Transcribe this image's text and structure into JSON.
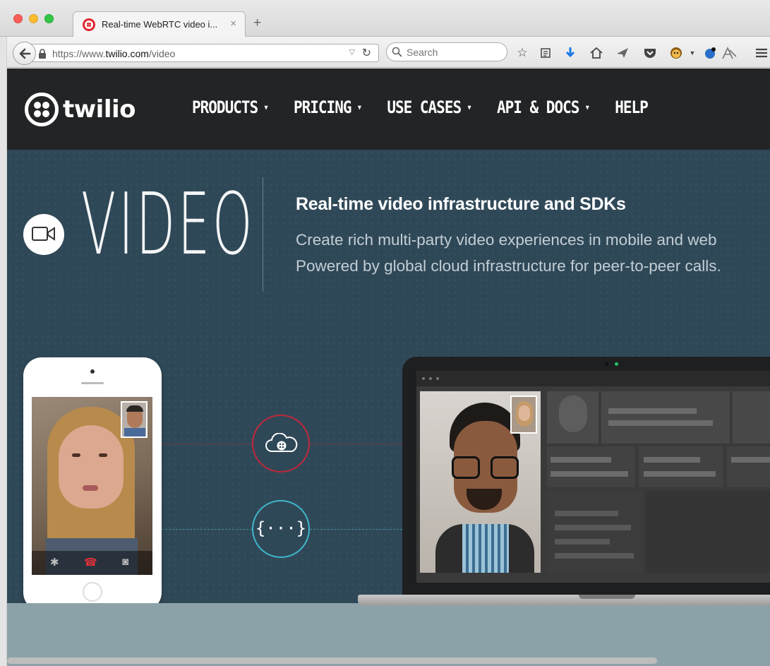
{
  "browser": {
    "tab": {
      "title": "Real-time WebRTC video i...",
      "close": "×"
    },
    "new_tab": "+",
    "url": {
      "scheme": "https://www.",
      "domain": "twilio.com",
      "path": "/video"
    },
    "search": {
      "placeholder": "Search"
    },
    "toolbar_icons": [
      "star-icon",
      "reading-list-icon",
      "download-icon",
      "home-icon",
      "send-icon",
      "pocket-icon",
      "monkey-icon",
      "globe-icon",
      "font-icon",
      "menu-icon"
    ]
  },
  "site": {
    "logo_text": "twilio",
    "nav": [
      {
        "label": "PRODUCTS",
        "caret": "▾"
      },
      {
        "label": "PRICING",
        "caret": "▾"
      },
      {
        "label": "USE CASES",
        "caret": "▾"
      },
      {
        "label": "API & DOCS",
        "caret": "▾"
      },
      {
        "label": "HELP",
        "caret": ""
      }
    ]
  },
  "hero": {
    "product": "VIDEO",
    "heading": "Real-time video infrastructure and SDKs",
    "line1": "Create rich multi-party video experiences in mobile and web",
    "line2": "Powered by global cloud infrastructure for peer-to-peer calls."
  },
  "illustration": {
    "api_symbol": "{···}",
    "colors": {
      "red": "#c0283a",
      "teal": "#3fb6c9"
    }
  }
}
